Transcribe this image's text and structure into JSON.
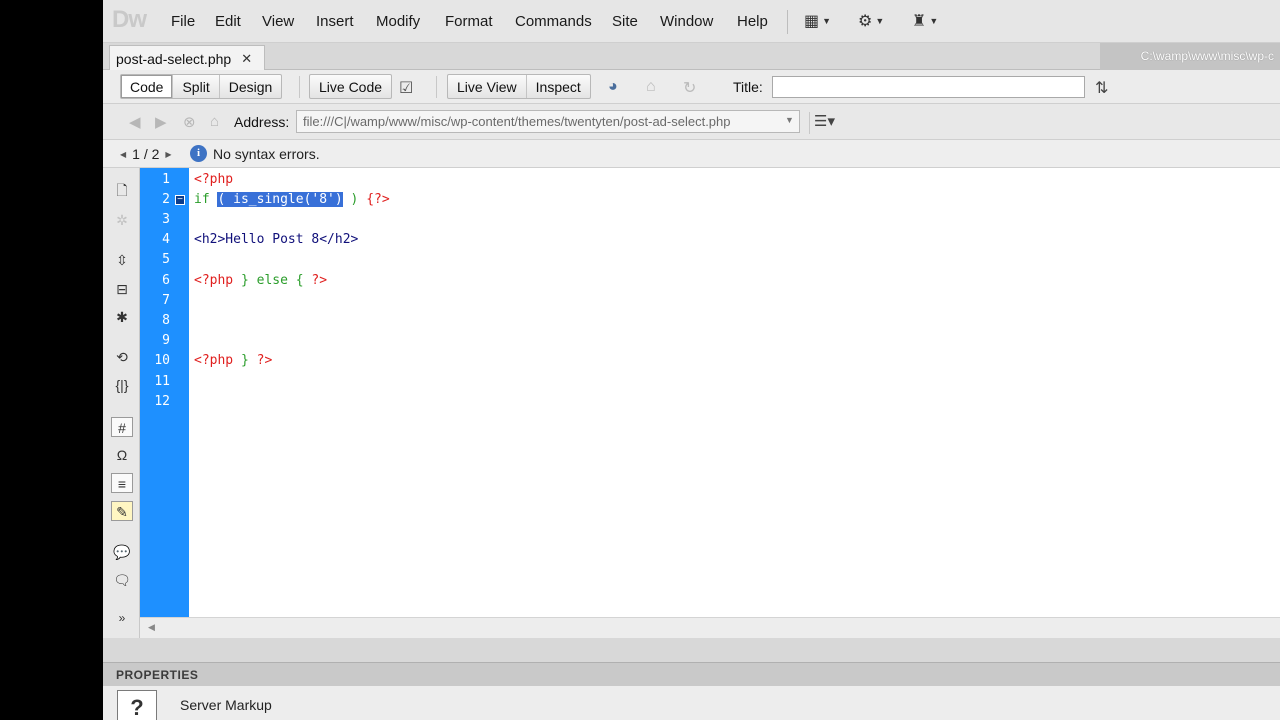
{
  "app": {
    "logo": "Dw",
    "menu": [
      "File",
      "Edit",
      "View",
      "Insert",
      "Modify",
      "Format",
      "Commands",
      "Site",
      "Window",
      "Help"
    ]
  },
  "document": {
    "tab_name": "post-ad-select.php",
    "path": "C:\\wamp\\www\\misc\\wp-c"
  },
  "toolbar": {
    "code": "Code",
    "split": "Split",
    "design": "Design",
    "live_code": "Live Code",
    "live_view": "Live View",
    "inspect": "Inspect",
    "title_label": "Title:",
    "title_value": ""
  },
  "address": {
    "label": "Address:",
    "value": "file:///C|/wamp/www/misc/wp-content/themes/twentyten/post-ad-select.php"
  },
  "info": {
    "nav": "1 / 2",
    "message": "No syntax errors."
  },
  "editor": {
    "line_numbers": [
      "1",
      "2",
      "3",
      "4",
      "5",
      "6",
      "7",
      "8",
      "9",
      "10",
      "11",
      "12"
    ],
    "lines": {
      "l1": "<?php",
      "l2_if": "if ",
      "l2_sel": "( is_single('8')",
      "l2_rest": " ) ",
      "l2_close": "{?>",
      "l4": "<h2>Hello Post 8</h2>",
      "l6_open": "<?php",
      "l6_mid": " } else { ",
      "l6_close": "?>",
      "l10_open": "<?php",
      "l10_mid": " } ",
      "l10_close": "?>"
    }
  },
  "properties": {
    "header": "PROPERTIES",
    "label": "Server Markup",
    "icon_glyph": "?"
  }
}
